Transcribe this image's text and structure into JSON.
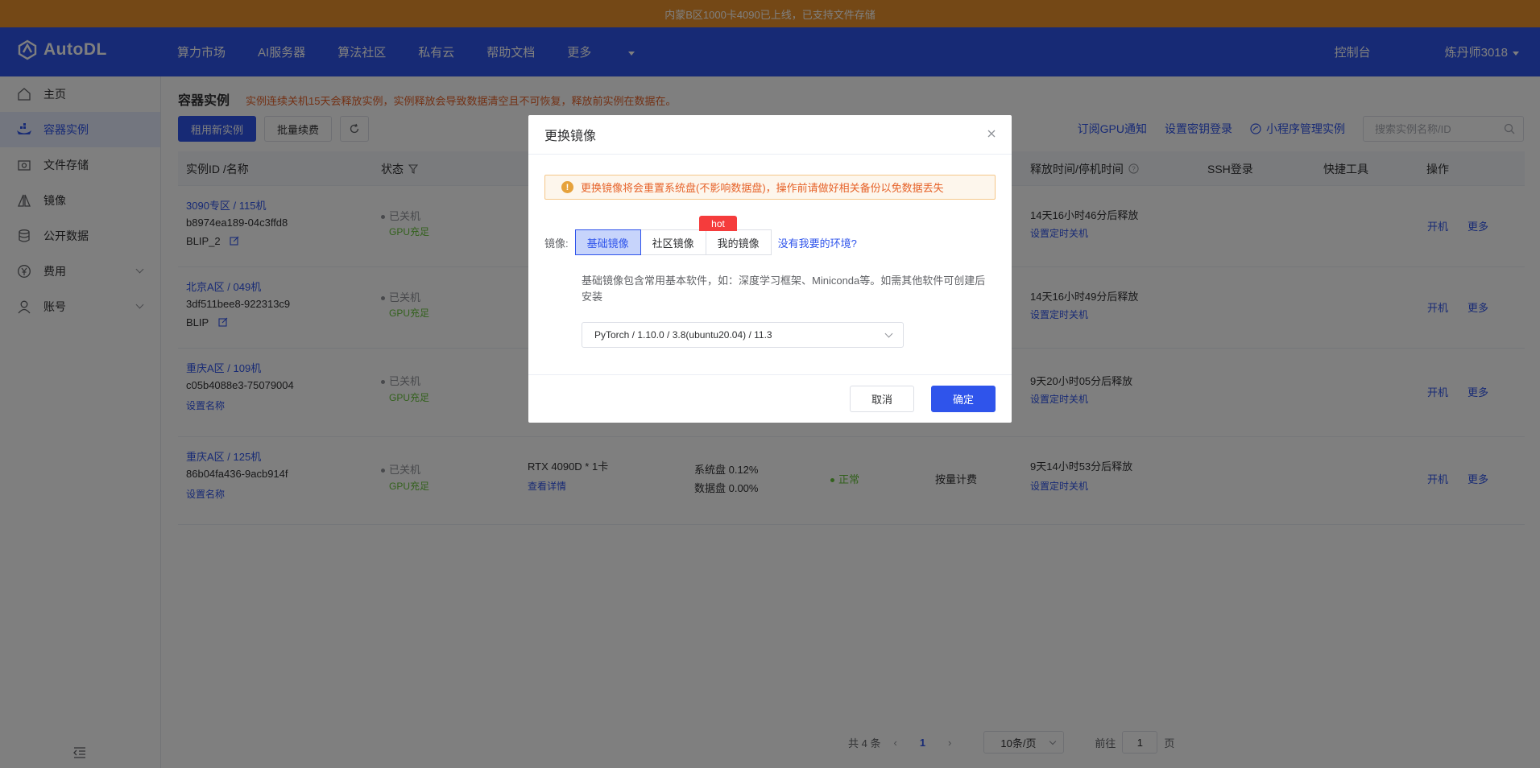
{
  "banner": {
    "text": "内蒙B区1000卡4090已上线，已支持文件存储"
  },
  "brand": {
    "name": "AutoDL"
  },
  "topnav": {
    "links": [
      "算力市场",
      "AI服务器",
      "算法社区",
      "私有云",
      "帮助文档",
      "更多"
    ],
    "console": "控制台",
    "user": "炼丹师3018"
  },
  "sidebar": {
    "items": [
      {
        "label": "主页",
        "icon": "home-icon"
      },
      {
        "label": "容器实例",
        "icon": "container-icon",
        "active": true
      },
      {
        "label": "文件存储",
        "icon": "storage-icon"
      },
      {
        "label": "镜像",
        "icon": "image-icon"
      },
      {
        "label": "公开数据",
        "icon": "database-icon"
      },
      {
        "label": "费用",
        "icon": "yen-icon",
        "expandable": true
      },
      {
        "label": "账号",
        "icon": "user-icon",
        "expandable": true
      }
    ]
  },
  "page": {
    "title": "容器实例",
    "warning": "实例连续关机15天会释放实例，实例释放会导致数据清空且不可恢复，释放前实例在数据在。"
  },
  "toolbar": {
    "rent_new": "租用新实例",
    "batch_renew": "批量续费",
    "subscribe_gpu": "订阅GPU通知",
    "set_key": "设置密钥登录",
    "mini_program": "小程序管理实例",
    "search_placeholder": "搜索实例名称/ID"
  },
  "table": {
    "headers": {
      "id": "实例ID /名称",
      "status": "状态",
      "release": "释放时间/停机时间",
      "ssh": "SSH登录",
      "tools": "快捷工具",
      "ops": "操作"
    },
    "rows": [
      {
        "region": "3090专区 / 115机",
        "id": "b8974ea189-04c3ffd8",
        "name": "BLIP_2",
        "status": "已关机",
        "gpu_status": "GPU充足",
        "release": "14天16小时46分后释放",
        "timer": "设置定时关机",
        "op_start": "开机",
        "op_more": "更多"
      },
      {
        "region": "北京A区 / 049机",
        "id": "3df511bee8-922313c9",
        "name": "BLIP",
        "status": "已关机",
        "gpu_status": "GPU充足",
        "release": "14天16小时49分后释放",
        "timer": "设置定时关机",
        "op_start": "开机",
        "op_more": "更多"
      },
      {
        "region": "重庆A区 / 109机",
        "id": "c05b4088e3-75079004",
        "set_name": "设置名称",
        "status": "已关机",
        "gpu_status": "GPU充足",
        "release": "9天20小时05分后释放",
        "timer": "设置定时关机",
        "op_start": "开机",
        "op_more": "更多"
      },
      {
        "region": "重庆A区 / 125机",
        "id": "86b04fa436-9acb914f",
        "set_name": "设置名称",
        "status": "已关机",
        "gpu_status": "GPU充足",
        "spec": "RTX 4090D * 1卡",
        "spec_link": "查看详情",
        "sys_disk": "系统盘 0.12%",
        "data_disk": "数据盘 0.00%",
        "health": "正常",
        "billing": "按量计费",
        "release": "9天14小时53分后释放",
        "timer": "设置定时关机",
        "op_start": "开机",
        "op_more": "更多"
      }
    ]
  },
  "pager": {
    "total": "共 4 条",
    "current": "1",
    "page_size": "10条/页",
    "goto_prefix": "前往",
    "goto_value": "1",
    "goto_suffix": "页"
  },
  "modal": {
    "title": "更换镜像",
    "alert": "更换镜像将会重置系统盘(不影响数据盘)，操作前请做好相关备份以免数据丢失",
    "image_label": "镜像:",
    "tabs": [
      "基础镜像",
      "社区镜像",
      "我的镜像"
    ],
    "hot_badge": "hot",
    "no_match": "没有我要的环境?",
    "description": "基础镜像包含常用基本软件，如：深度学习框架、Miniconda等。如需其他软件可创建后安装",
    "selected_image": "PyTorch / 1.10.0 / 3.8(ubuntu20.04) / 11.3",
    "cancel": "取消",
    "confirm": "确定"
  },
  "colors": {
    "brand": "#2f54eb",
    "banner": "#e8912c",
    "warning": "#e6632a",
    "success": "#67c23a"
  }
}
